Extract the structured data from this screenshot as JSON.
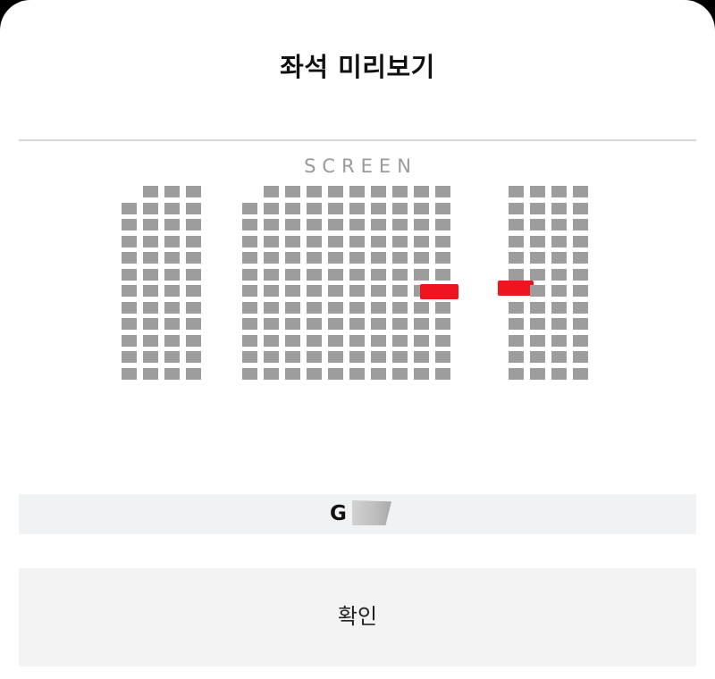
{
  "dialog": {
    "title": "좌석 미리보기"
  },
  "screen": {
    "label": "SCREEN"
  },
  "seat_map": {
    "seat_color": "#9d9d9d",
    "selected_color": "#f0141e",
    "sections": [
      {
        "name": "left",
        "columns": 4,
        "rows": 12,
        "first_row_missing_columns": [
          0
        ],
        "selected": []
      },
      {
        "name": "center",
        "columns": 10,
        "rows": 12,
        "first_row_missing_columns": [
          0
        ],
        "selected": [
          [
            6,
            9
          ]
        ]
      },
      {
        "name": "right",
        "columns": 4,
        "rows": 12,
        "first_row_missing_columns": [],
        "selected": [
          [
            6,
            0
          ]
        ]
      }
    ]
  },
  "selection": {
    "text": "G"
  },
  "confirm": {
    "label": "확인"
  }
}
